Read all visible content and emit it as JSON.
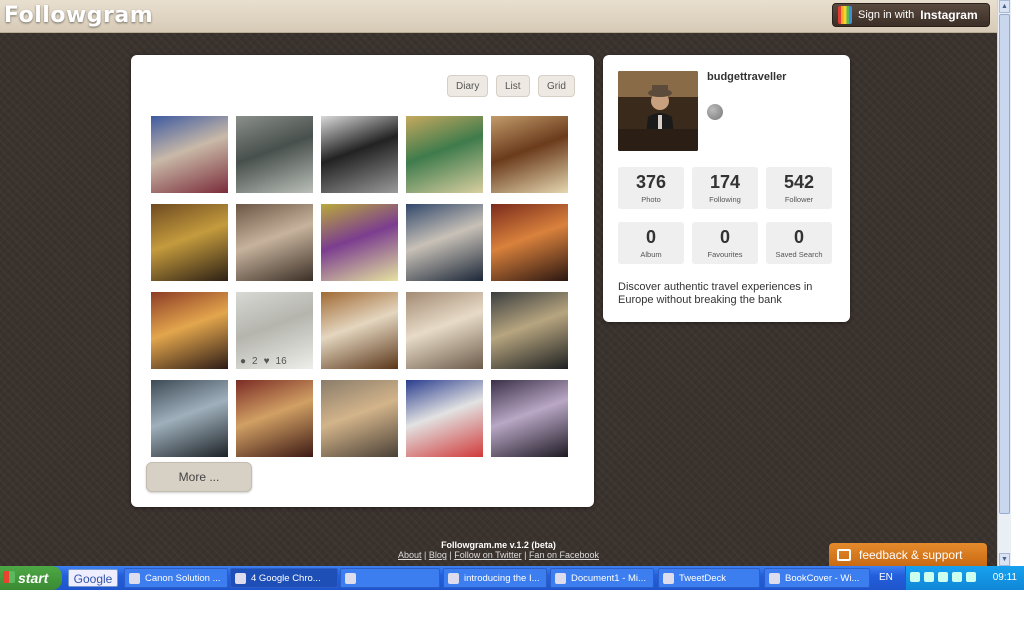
{
  "app": {
    "logo": "Followgram"
  },
  "header": {
    "signin_prefix": "Sign in with",
    "signin_brand": "Instagram"
  },
  "views": {
    "diary": "Diary",
    "list": "List",
    "grid": "Grid"
  },
  "photos": [
    {
      "colors": [
        "#3d5aa0",
        "#c9b9a8",
        "#7a2c39"
      ]
    },
    {
      "colors": [
        "#8a8f8a",
        "#48504d",
        "#babfb8"
      ]
    },
    {
      "colors": [
        "#d9d9d9",
        "#222",
        "#9a9a9a"
      ]
    },
    {
      "colors": [
        "#c6a95f",
        "#3f7b4c",
        "#d9cfa0"
      ]
    },
    {
      "colors": [
        "#c29b6a",
        "#6b3b1c",
        "#e6d7b0"
      ]
    },
    {
      "colors": [
        "#6e4a21",
        "#c49b3d",
        "#2d2015"
      ]
    },
    {
      "colors": [
        "#6b5644",
        "#c7b39d",
        "#3b2f26"
      ]
    },
    {
      "colors": [
        "#b9a93d",
        "#7b3d8f",
        "#e6e3a0"
      ]
    },
    {
      "colors": [
        "#31486b",
        "#c8c1b7",
        "#1c2738"
      ]
    },
    {
      "colors": [
        "#7a2b1c",
        "#d9813c",
        "#2b1611"
      ]
    },
    {
      "colors": [
        "#8d3c26",
        "#e3a64c",
        "#2d1c16"
      ]
    },
    {
      "colors": [
        "#d8d8d4",
        "#b5b5ae",
        "#eeeeea"
      ],
      "meta": {
        "comments": "2",
        "likes": "16"
      }
    },
    {
      "colors": [
        "#a06a35",
        "#e4d6bf",
        "#5a3619"
      ]
    },
    {
      "colors": [
        "#a38a74",
        "#e7dbc7",
        "#6c5a4a"
      ]
    },
    {
      "colors": [
        "#3b3e3f",
        "#b7a57f",
        "#1e2021"
      ]
    },
    {
      "colors": [
        "#3d4a55",
        "#9fb0bc",
        "#1d2327"
      ]
    },
    {
      "colors": [
        "#7b2c25",
        "#d1a064",
        "#3d1914"
      ]
    },
    {
      "colors": [
        "#8a7c6a",
        "#d3b48a",
        "#4a4036"
      ]
    },
    {
      "colors": [
        "#2a3d8f",
        "#e2e2e2",
        "#d13a3a"
      ]
    },
    {
      "colors": [
        "#3b3048",
        "#b9a7c5",
        "#1e1a24"
      ]
    }
  ],
  "more_button": "More ...",
  "profile": {
    "username": "budgettraveller",
    "stats": [
      {
        "num": "376",
        "label": "Photo"
      },
      {
        "num": "174",
        "label": "Following"
      },
      {
        "num": "542",
        "label": "Follower"
      },
      {
        "num": "0",
        "label": "Album"
      },
      {
        "num": "0",
        "label": "Favourites"
      },
      {
        "num": "0",
        "label": "Saved Search"
      }
    ],
    "bio": "Discover authentic travel experiences in Europe without breaking the bank"
  },
  "footer": {
    "version": "Followgram.me v.1.2 (beta)",
    "about": "About",
    "blog": "Blog",
    "twitter": "Follow on Twitter",
    "facebook": "Fan on Facebook",
    "sep": " | "
  },
  "feedback": "feedback & support",
  "taskbar": {
    "start": "start",
    "google": "Google",
    "tasks": [
      {
        "label": "Canon Solution ..."
      },
      {
        "label": "4 Google Chro...",
        "active": true
      },
      {
        "label": ""
      },
      {
        "label": "introducing the I..."
      },
      {
        "label": "Document1 - Mi..."
      },
      {
        "label": "TweetDeck"
      },
      {
        "label": "BookCover - Wi..."
      }
    ],
    "lang": "EN",
    "clock": "09:11"
  }
}
